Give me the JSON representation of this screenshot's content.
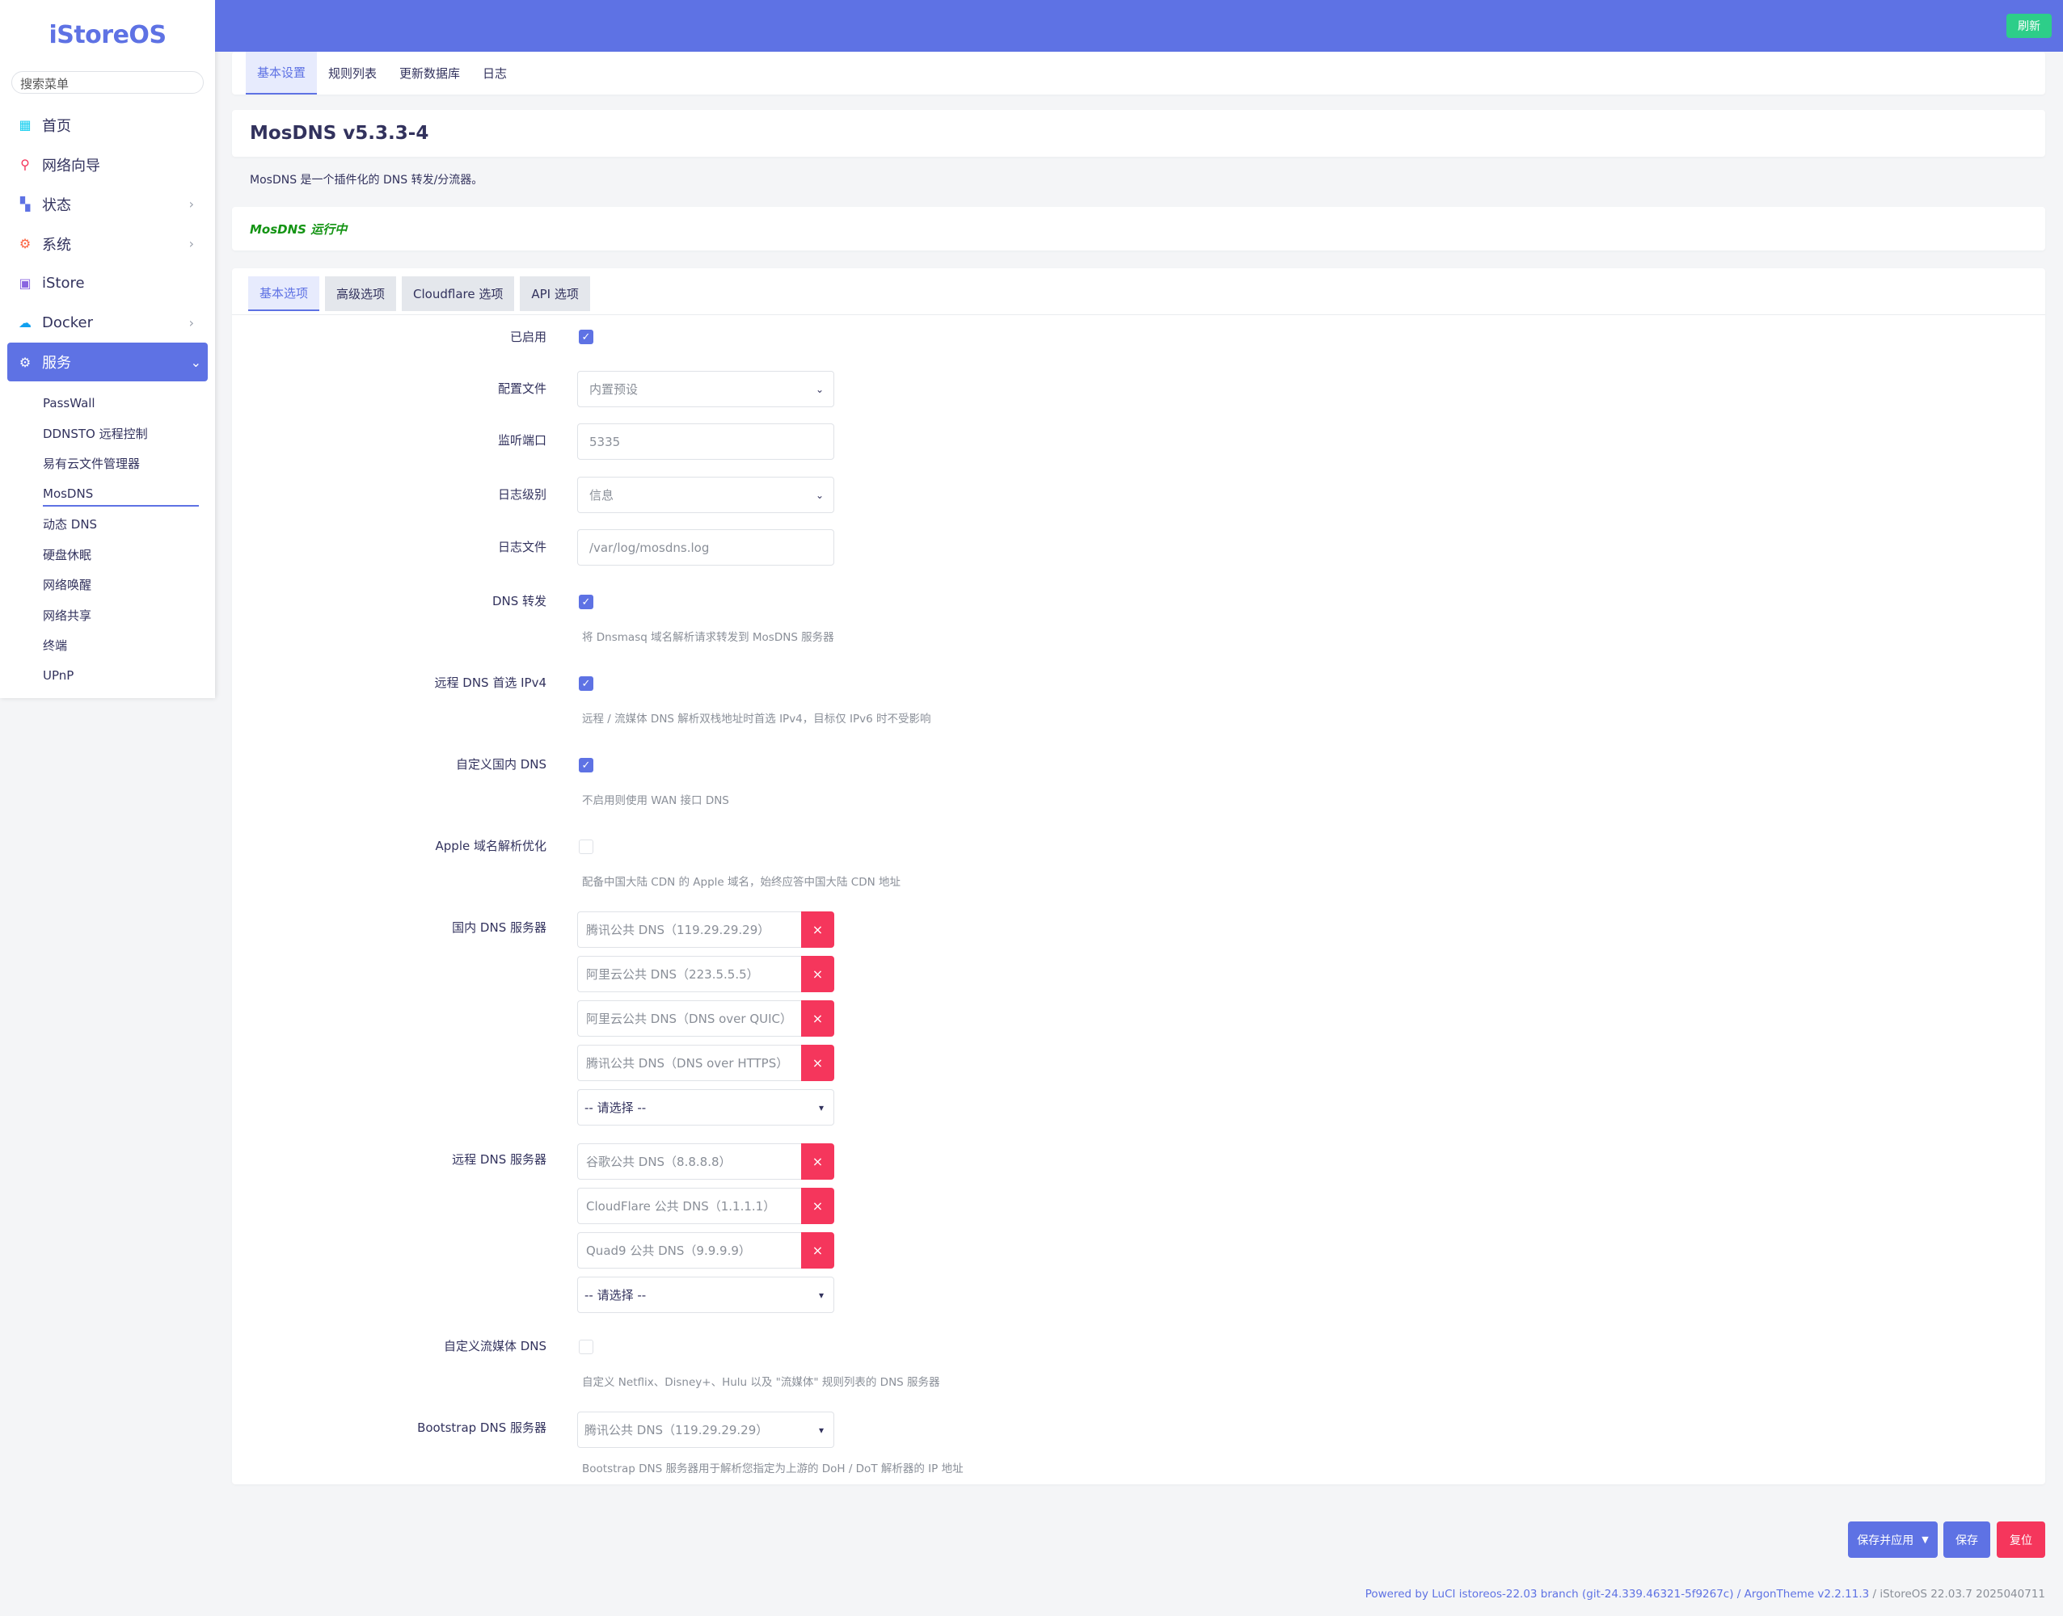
{
  "sidebar": {
    "logo": "iStoreOS",
    "search_placeholder": "搜索菜单",
    "items": [
      {
        "label": "首页"
      },
      {
        "label": "网络向导"
      },
      {
        "label": "状态"
      },
      {
        "label": "系统"
      },
      {
        "label": "iStore"
      },
      {
        "label": "Docker"
      },
      {
        "label": "服务"
      }
    ],
    "sub_items": [
      {
        "label": "PassWall"
      },
      {
        "label": "DDNSTO 远程控制"
      },
      {
        "label": "易有云文件管理器"
      },
      {
        "label": "MosDNS"
      },
      {
        "label": "动态 DNS"
      },
      {
        "label": "硬盘休眠"
      },
      {
        "label": "网络唤醒"
      },
      {
        "label": "网络共享"
      },
      {
        "label": "终端"
      },
      {
        "label": "UPnP"
      }
    ]
  },
  "header": {
    "refresh_label": "刷新"
  },
  "tabs": [
    {
      "label": "基本设置"
    },
    {
      "label": "规则列表"
    },
    {
      "label": "更新数据库"
    },
    {
      "label": "日志"
    }
  ],
  "page": {
    "title": "MosDNS v5.3.3-4",
    "description": "MosDNS 是一个插件化的 DNS 转发/分流器。",
    "status": "MosDNS 运行中"
  },
  "subtabs": [
    {
      "label": "基本选项"
    },
    {
      "label": "高级选项"
    },
    {
      "label": "Cloudflare 选项"
    },
    {
      "label": "API 选项"
    }
  ],
  "form": {
    "enabled": {
      "label": "已启用",
      "checked": true
    },
    "config_file": {
      "label": "配置文件",
      "value": "内置预设"
    },
    "listen_port": {
      "label": "监听端口",
      "placeholder": "5335"
    },
    "log_level": {
      "label": "日志级别",
      "value": "信息"
    },
    "log_file": {
      "label": "日志文件",
      "placeholder": "/var/log/mosdns.log"
    },
    "dns_forward": {
      "label": "DNS 转发",
      "checked": true,
      "hint": "将 Dnsmasq 域名解析请求转发到 MosDNS 服务器"
    },
    "prefer_ipv4": {
      "label": "远程 DNS 首选 IPv4",
      "checked": true,
      "hint": "远程 / 流媒体 DNS 解析双栈地址时首选 IPv4，目标仅 IPv6 时不受影响"
    },
    "custom_local_dns": {
      "label": "自定义国内 DNS",
      "checked": true,
      "hint": "不启用则使用 WAN 接口 DNS"
    },
    "apple_opt": {
      "label": "Apple 域名解析优化",
      "checked": false,
      "hint": "配备中国大陆 CDN 的 Apple 域名，始终应答中国大陆 CDN 地址"
    },
    "local_dns": {
      "label": "国内 DNS 服务器",
      "values": [
        "腾讯公共 DNS（119.29.29.29）",
        "阿里云公共 DNS（223.5.5.5）",
        "阿里云公共 DNS（DNS over QUIC）",
        "腾讯公共 DNS（DNS over HTTPS）"
      ],
      "select_placeholder": "-- 请选择 --"
    },
    "remote_dns": {
      "label": "远程 DNS 服务器",
      "values": [
        "谷歌公共 DNS（8.8.8.8）",
        "CloudFlare 公共 DNS（1.1.1.1）",
        "Quad9 公共 DNS（9.9.9.9）"
      ],
      "select_placeholder": "-- 请选择 --"
    },
    "custom_stream_dns": {
      "label": "自定义流媒体 DNS",
      "checked": false,
      "hint": "自定义 Netflix、Disney+、Hulu 以及 \"流媒体\" 规则列表的 DNS 服务器"
    },
    "bootstrap_dns": {
      "label": "Bootstrap DNS 服务器",
      "value": "腾讯公共 DNS（119.29.29.29）",
      "hint": "Bootstrap DNS 服务器用于解析您指定为上游的 DoH / DoT 解析器的 IP 地址"
    }
  },
  "actions": {
    "apply_label": "保存并应用",
    "save_label": "保存",
    "reset_label": "复位"
  },
  "footer": {
    "text": "Powered by LuCI istoreos-22.03 branch (git-24.339.46321-5f9267c) / ArgonTheme v2.2.11.3",
    "version": " / iStoreOS 22.03.7 2025040711"
  },
  "colors": {
    "accent": "#5e72e4",
    "danger": "#f5365c",
    "success": "#2dce89",
    "status_running": "#149414"
  }
}
